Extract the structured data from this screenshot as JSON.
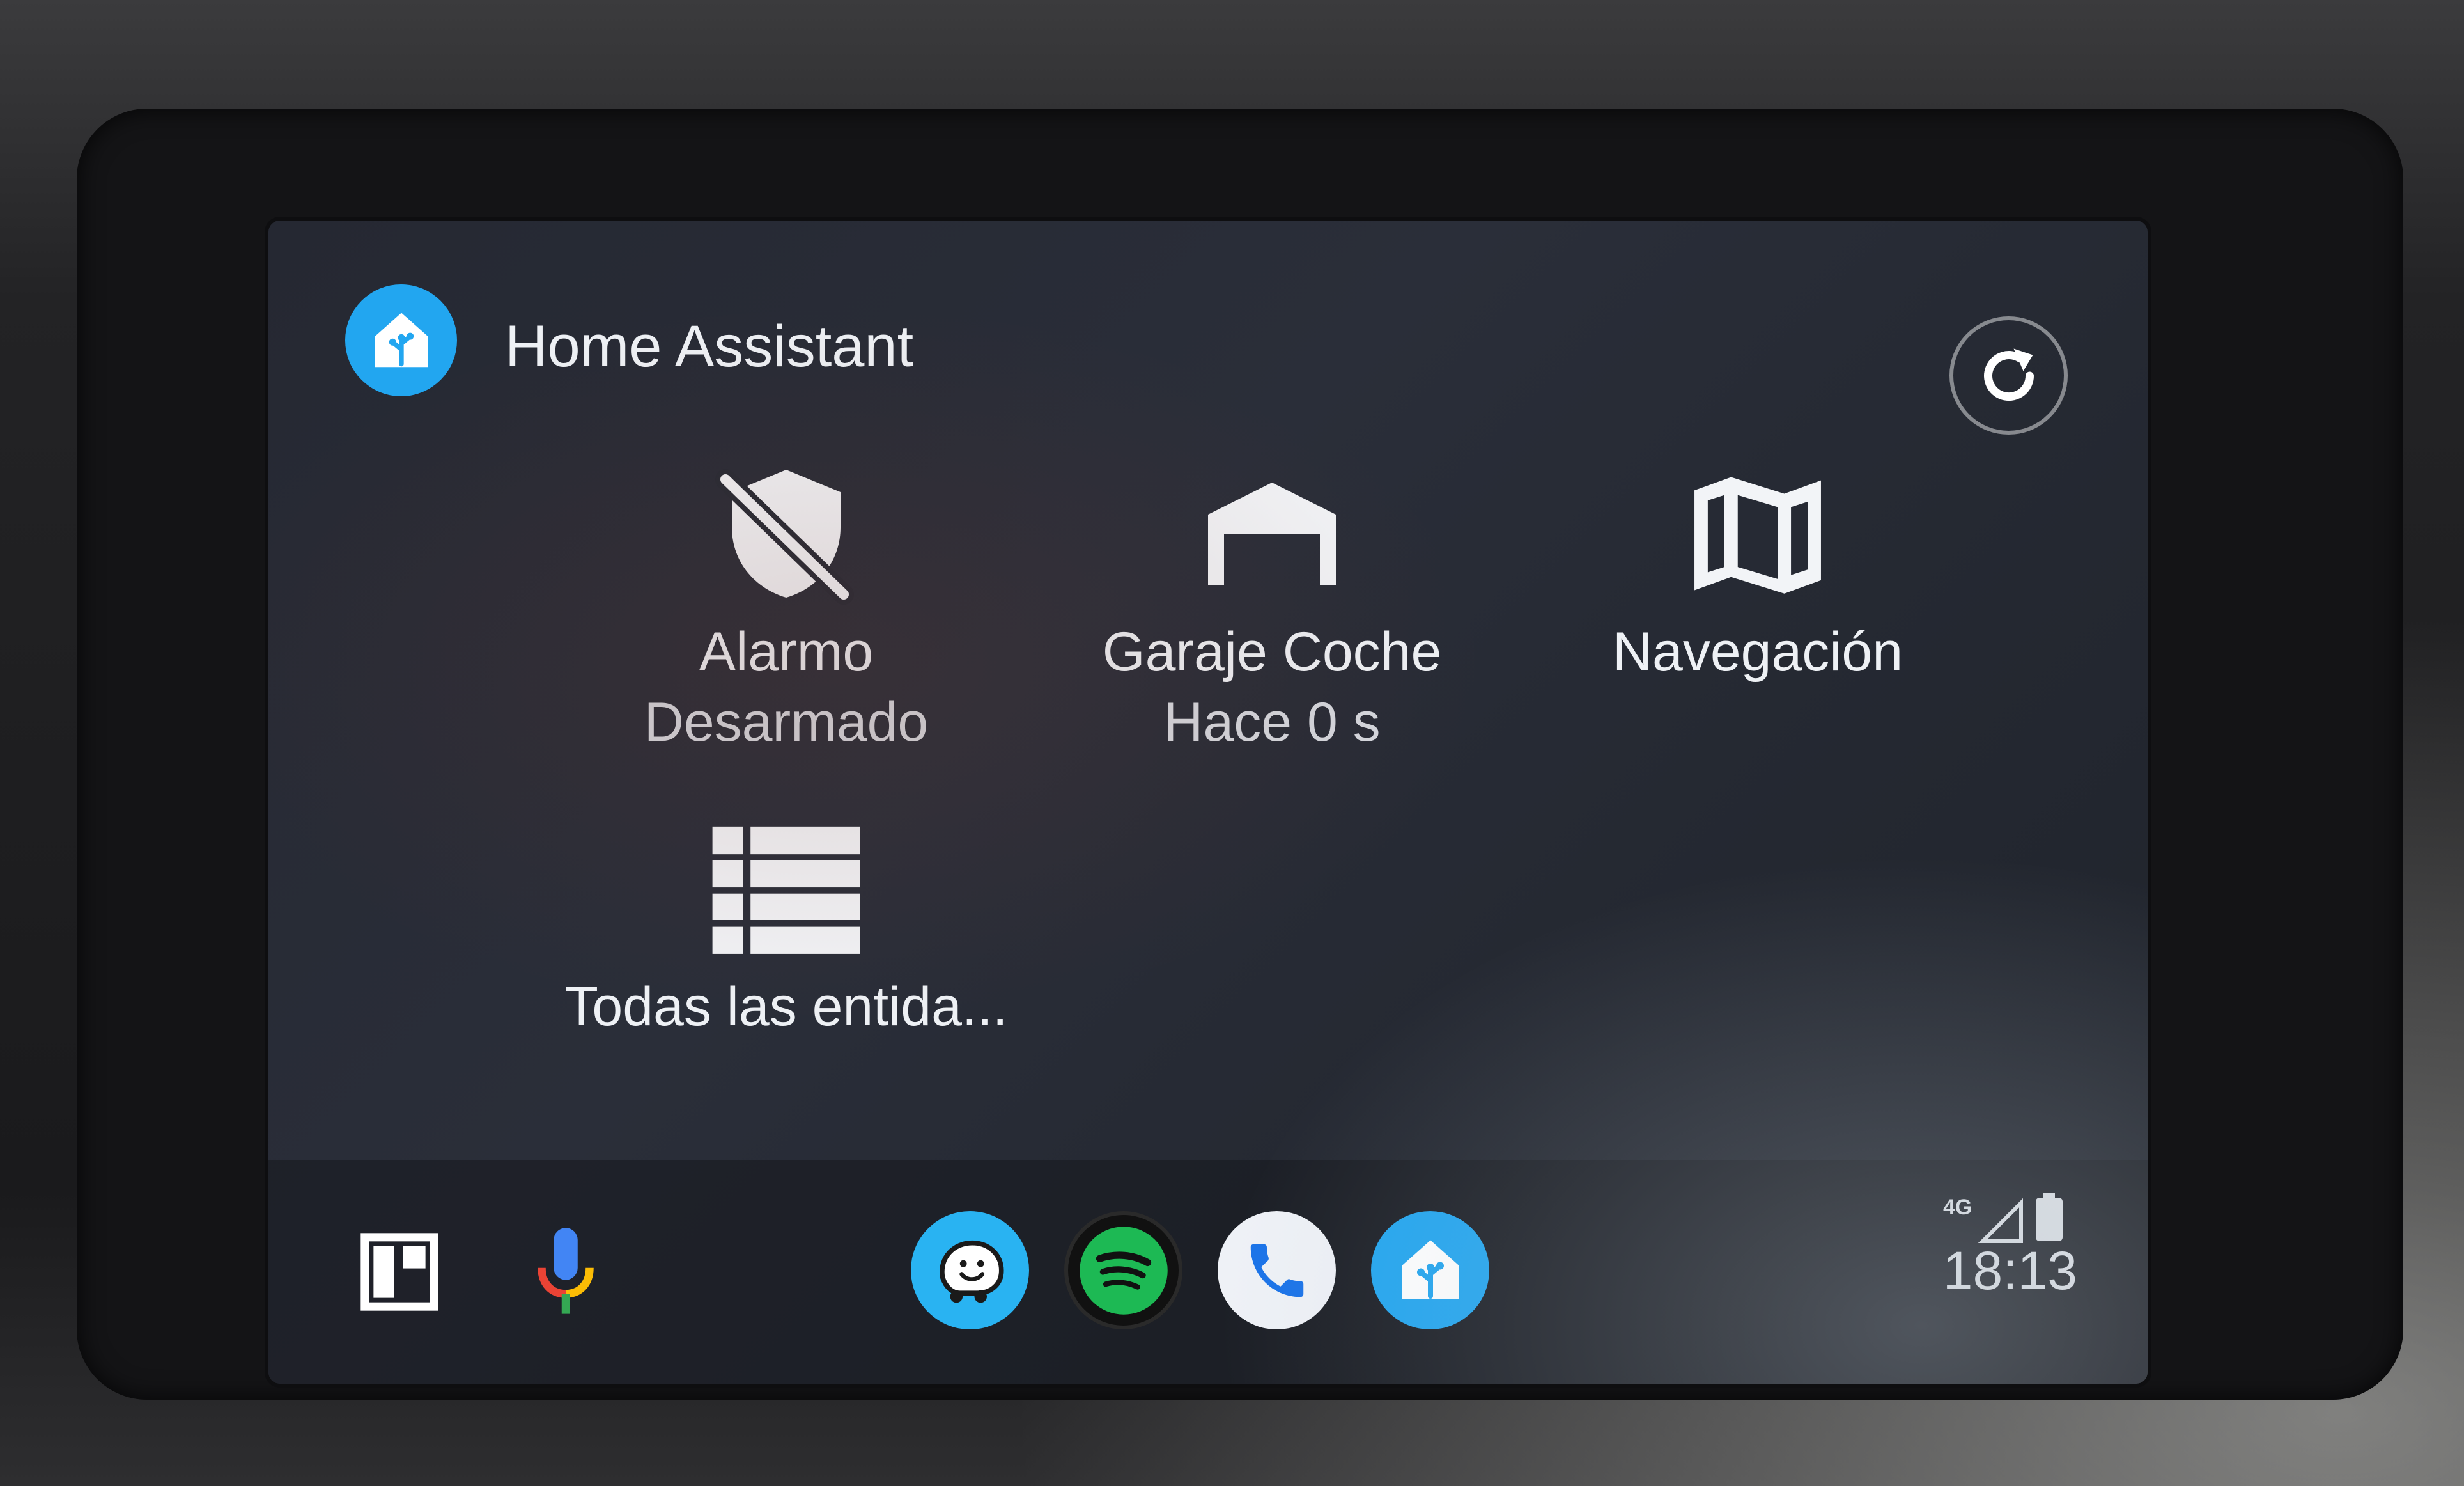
{
  "header": {
    "title": "Home Assistant",
    "logo_icon": "home-assistant-logo-icon",
    "refresh_icon": "refresh-icon"
  },
  "tiles": [
    {
      "name": "Alarmo",
      "status": "Desarmado",
      "icon": "shield-off-icon"
    },
    {
      "name": "Garaje Coche",
      "status": "Hace 0 s",
      "icon": "garage-icon"
    },
    {
      "name": "Navegación",
      "status": "",
      "icon": "map-icon"
    },
    {
      "name": "Todas las entida...",
      "status": "",
      "icon": "list-grid-icon"
    }
  ],
  "bottom_bar": {
    "dashboard_icon": "dashboard-icon",
    "mic_icon": "microphone-icon",
    "apps": [
      {
        "icon": "waze-icon"
      },
      {
        "icon": "spotify-icon"
      },
      {
        "icon": "phone-icon"
      },
      {
        "icon": "home-assistant-icon"
      }
    ],
    "network": "4G",
    "clock": "18:13"
  },
  "colors": {
    "ha_blue": "#22a6f0",
    "spotify_green": "#1db954",
    "waze_blue": "#29b3f2",
    "screen_bg": "#262a34"
  }
}
